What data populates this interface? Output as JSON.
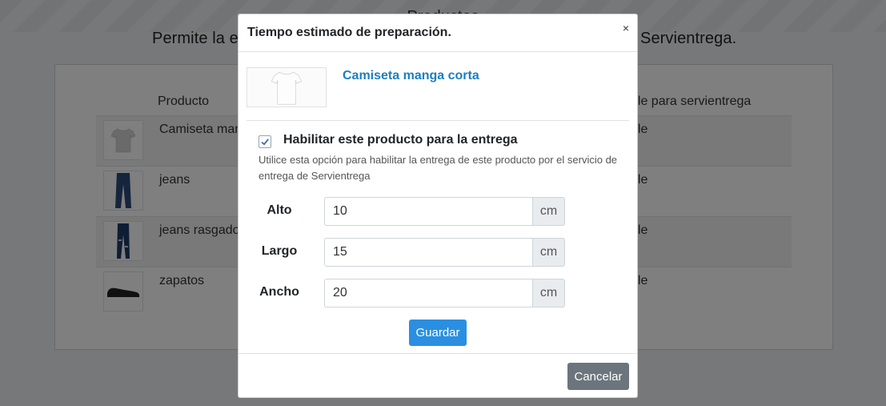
{
  "background": {
    "title": "Productos",
    "subtitle_left": "Permite la e",
    "subtitle_right": "Servientrega.",
    "table": {
      "headers": [
        "Producto",
        "ble para servientrega"
      ],
      "rows": [
        {
          "name": "Camiseta man",
          "available": "ble",
          "icon": "tshirt-icon"
        },
        {
          "name": "jeans",
          "available": "ble",
          "icon": "jeans-icon"
        },
        {
          "name": "jeans rasgado",
          "available": "ble",
          "icon": "ripped-jeans-icon"
        },
        {
          "name": "zapatos",
          "available": "ble",
          "icon": "shoes-icon"
        }
      ]
    }
  },
  "modal": {
    "title": "Tiempo estimado de preparación.",
    "close_label": "×",
    "product_name": "Camiseta manga corta",
    "enable_label": "Habilitar este producto para la entrega",
    "enable_checked": true,
    "help_text": "Utilice esta opción para habilitar la entrega de este producto por el servicio de entrega de Servientrega",
    "fields": [
      {
        "label": "Alto",
        "value": "10",
        "unit": "cm"
      },
      {
        "label": "Largo",
        "value": "15",
        "unit": "cm"
      },
      {
        "label": "Ancho",
        "value": "20",
        "unit": "cm"
      }
    ],
    "save_label": "Guardar",
    "cancel_label": "Cancelar"
  },
  "colors": {
    "link": "#1a7fc1",
    "primary": "#2a8fe0",
    "secondary": "#6c757d"
  }
}
